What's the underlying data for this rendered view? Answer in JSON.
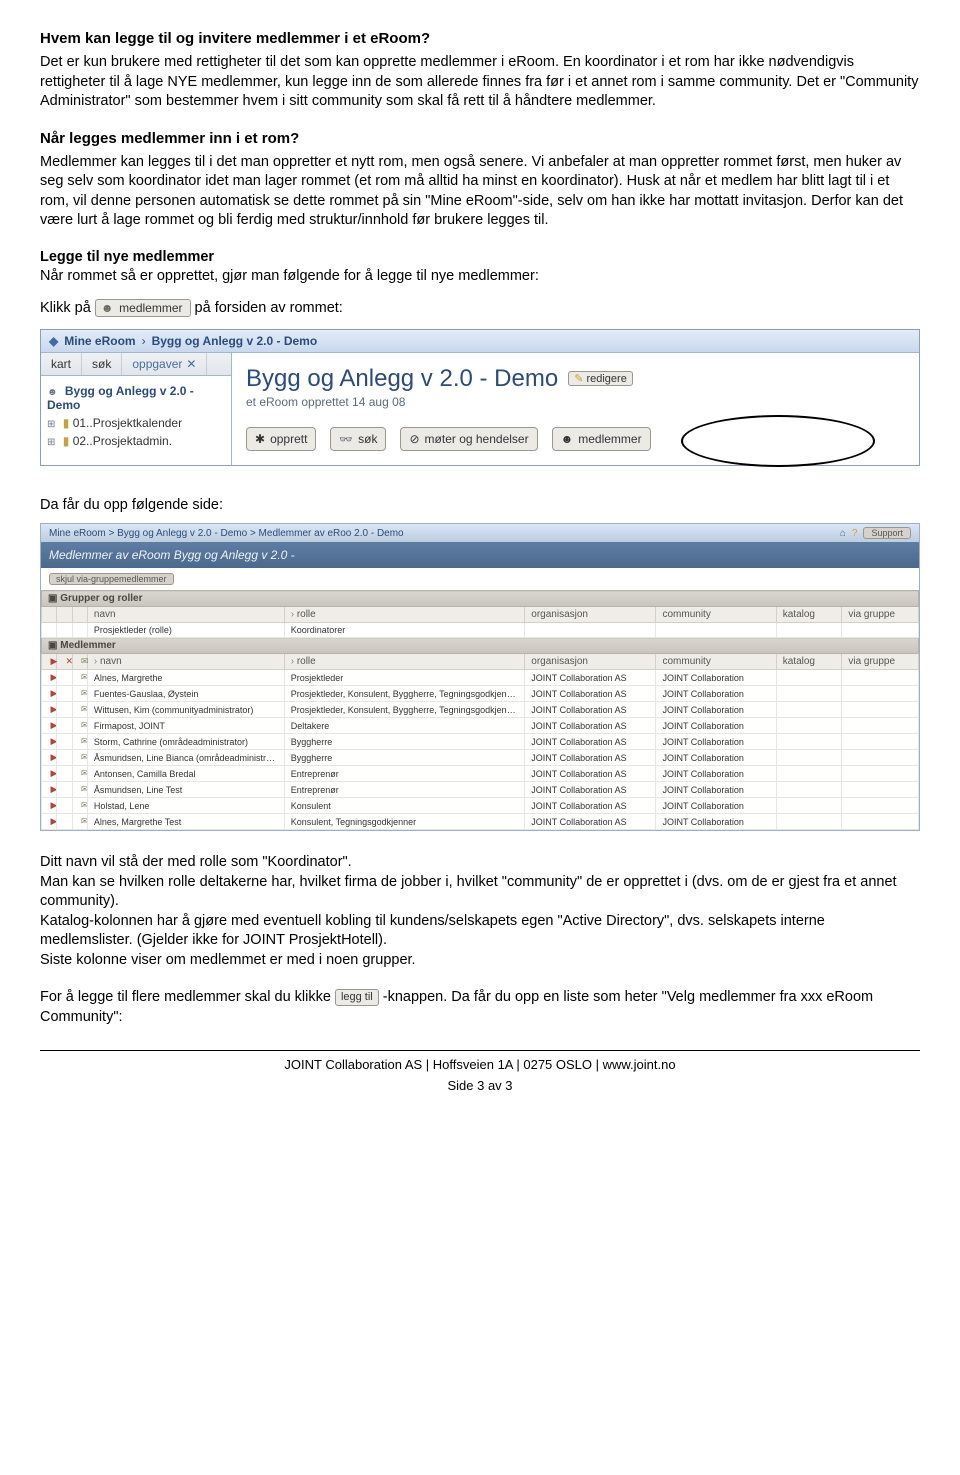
{
  "h1": "Hvem kan legge til og invitere medlemmer i et eRoom?",
  "p1": "Det er kun brukere med rettigheter til det som kan opprette medlemmer i eRoom. En koordinator i et rom har ikke nødvendigvis rettigheter til å lage NYE medlemmer, kun legge inn de som allerede finnes fra før i et annet rom i samme community. Det er \"Community Administrator\" som bestemmer hvem i sitt community som skal få rett til å håndtere medlemmer.",
  "h2": "Når legges medlemmer inn i et rom?",
  "p2": "Medlemmer kan legges til i det man oppretter et nytt rom, men også senere. Vi anbefaler at man oppretter rommet først, men huker av seg selv som koordinator idet man lager rommet (et rom må alltid ha minst en koordinator). Husk at når et medlem har blitt lagt til i et rom, vil denne personen automatisk se dette rommet på sin \"Mine eRoom\"-side, selv om han ikke har mottatt invitasjon. Derfor kan det være lurt å lage rommet og bli ferdig med struktur/innhold før brukere legges til.",
  "h3": "Legge til nye medlemmer",
  "p3": "Når rommet så er opprettet, gjør man følgende for å legge til nye medlemmer:",
  "line_klikk_pre": "Klikk på ",
  "chip_medlemmer": "medlemmer",
  "line_klikk_post": " på forsiden av rommet:",
  "shot1": {
    "crumb_left": "Mine eRoom",
    "crumb_right": "Bygg og Anlegg v 2.0 - Demo",
    "tabs": {
      "kart": "kart",
      "sok": "søk",
      "oppg": "oppgaver"
    },
    "tree": {
      "root": "Bygg og Anlegg v 2.0 - Demo",
      "n1": "01..Prosjektkalender",
      "n2": "02..Prosjektadmin."
    },
    "title": "Bygg og Anlegg v 2.0 - Demo",
    "edit": "redigere",
    "sub": "et eRoom opprettet 14 aug 08",
    "tb": {
      "opprett": "opprett",
      "sok": "søk",
      "moter": "møter og hendelser",
      "medl": "medlemmer"
    }
  },
  "p_da": "Da får du opp følgende side:",
  "shot2": {
    "crumb": "Mine eRoom > Bygg og Anlegg v 2.0 - Demo > Medlemmer av eRoo 2.0 - Demo",
    "support": "Support",
    "title": "Medlemmer av eRoom Bygg og Anlegg v 2.0 -",
    "hide": "skjul via-gruppemedlemmer",
    "sec_groups": "Grupper og roller",
    "cols": {
      "navn": "navn",
      "rolle": "rolle",
      "org": "organisasjon",
      "comm": "community",
      "katalog": "katalog",
      "via": "via gruppe"
    },
    "grp_row": {
      "navn": "Prosjektleder (rolle)",
      "rolle": "Koordinatorer"
    },
    "sec_members": "Medlemmer",
    "rows": [
      {
        "navn": "Alnes, Margrethe",
        "rolle": "Prosjektleder",
        "org": "JOINT Collaboration AS",
        "comm": "JOINT Collaboration"
      },
      {
        "navn": "Fuentes-Gauslaa, Øystein",
        "rolle": "Prosjektleder, Konsulent, Byggherre, Tegningsgodkjenner",
        "org": "JOINT Collaboration AS",
        "comm": "JOINT Collaboration"
      },
      {
        "navn": "Wittusen, Kim (communityadministrator)",
        "rolle": "Prosjektleder, Konsulent, Byggherre, Tegningsgodkjenner",
        "org": "JOINT Collaboration AS",
        "comm": "JOINT Collaboration"
      },
      {
        "navn": "Firmapost, JOINT",
        "rolle": "Deltakere",
        "org": "JOINT Collaboration AS",
        "comm": "JOINT Collaboration"
      },
      {
        "navn": "Storm, Cathrine (områdeadministrator)",
        "rolle": "Byggherre",
        "org": "JOINT Collaboration AS",
        "comm": "JOINT Collaboration"
      },
      {
        "navn": "Åsmundsen, Line Bianca (områdeadministrator)",
        "rolle": "Byggherre",
        "org": "JOINT Collaboration AS",
        "comm": "JOINT Collaboration"
      },
      {
        "navn": "Antonsen, Camilla Bredal",
        "rolle": "Entreprenør",
        "org": "JOINT Collaboration AS",
        "comm": "JOINT Collaboration"
      },
      {
        "navn": "Åsmundsen, Line Test",
        "rolle": "Entreprenør",
        "org": "JOINT Collaboration AS",
        "comm": "JOINT Collaboration"
      },
      {
        "navn": "Holstad, Lene",
        "rolle": "Konsulent",
        "org": "JOINT Collaboration AS",
        "comm": "JOINT Collaboration"
      },
      {
        "navn": "Alnes, Margrethe Test",
        "rolle": "Konsulent, Tegningsgodkjenner",
        "org": "JOINT Collaboration AS",
        "comm": "JOINT Collaboration"
      }
    ]
  },
  "p_after": "Ditt navn vil stå der med rolle som \"Koordinator\".\nMan kan se hvilken rolle deltakerne har, hvilket firma de jobber i, hvilket \"community\" de er opprettet i (dvs. om de er gjest fra et annet community).\nKatalog-kolonnen har å gjøre med eventuell kobling til kundens/selskapets egen \"Active Directory\", dvs. selskapets interne medlemslister. (Gjelder ikke for JOINT ProsjektHotell).\nSiste kolonne viser om medlemmet er med i noen grupper.",
  "line_legg_pre": "For å legge til flere medlemmer skal du klikke ",
  "chip_leggtil": "legg til",
  "line_legg_post": "-knappen. Da får du opp en liste som heter \"Velg medlemmer fra xxx eRoom Community\":",
  "footer": "JOINT Collaboration AS | Hoffsveien 1A | 0275 OSLO | www.joint.no",
  "footer2": "Side 3 av 3"
}
